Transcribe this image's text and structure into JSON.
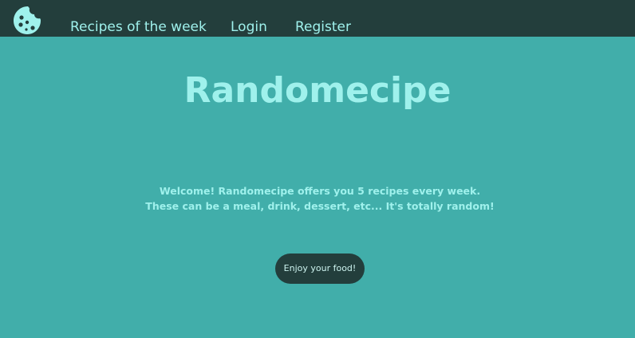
{
  "nav": {
    "logo_icon": "cookie-icon",
    "items": [
      {
        "label": "Recipes of the week"
      },
      {
        "label": "Login"
      },
      {
        "label": "Register"
      }
    ]
  },
  "hero": {
    "title": "Randomecipe",
    "description": "Welcome! Randomecipe offers you 5 recipes every week. These can be a meal, drink, dessert, etc... It's totally random!",
    "cta_label": "Enjoy your food!"
  },
  "colors": {
    "background": "#41aeaa",
    "navbar": "#233e3c",
    "accent_text": "#9ff1ec",
    "button": "#233e3c"
  }
}
